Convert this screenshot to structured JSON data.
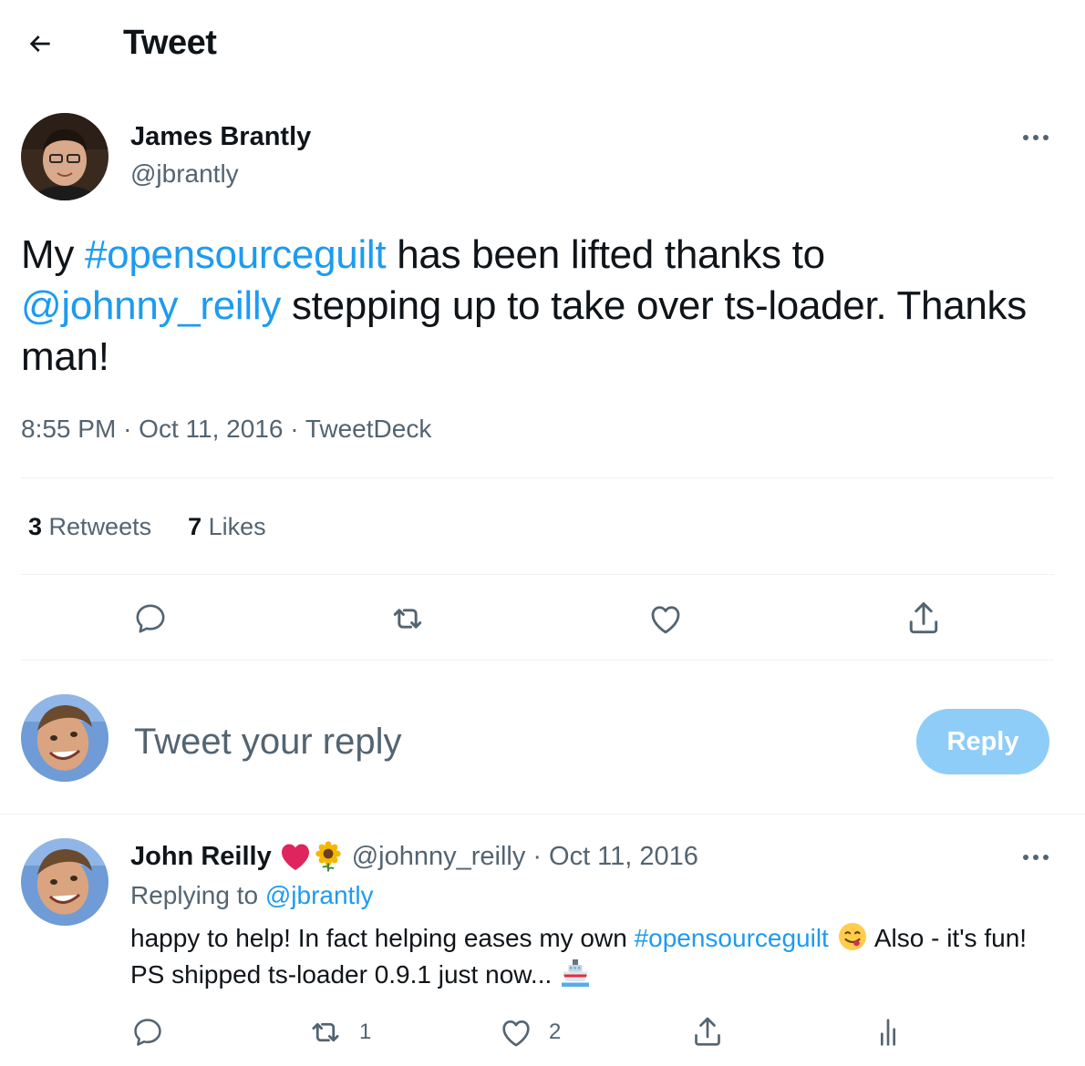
{
  "header": {
    "title": "Tweet"
  },
  "tweet": {
    "author_name": "James Brantly",
    "author_handle": "@jbrantly",
    "text_parts": [
      "My ",
      "#opensourceguilt",
      " has been lifted thanks to ",
      "@johnny_reilly",
      " stepping up to take over ts-loader. Thanks man!"
    ],
    "time": "8:55 PM",
    "date": "Oct 11, 2016",
    "source": "TweetDeck",
    "separator": "·",
    "retweets_count": "3",
    "retweets_label": "Retweets",
    "likes_count": "7",
    "likes_label": "Likes"
  },
  "composer": {
    "placeholder": "Tweet your reply",
    "reply_button": "Reply"
  },
  "reply": {
    "author_name": "John Reilly",
    "author_handle": "@johnny_reilly",
    "separator": "·",
    "date": "Oct 11, 2016",
    "replying_prefix": "Replying to ",
    "replying_to": "@jbrantly",
    "text_part1": "happy to help! In fact helping eases my own ",
    "text_hashtag": "#opensourceguilt",
    "text_part2": " Also - it's fun! PS shipped ts-loader 0.9.1 just now... ",
    "retweet_count": "1",
    "like_count": "2"
  },
  "colors": {
    "accent": "#1d9bf0",
    "muted": "#536471",
    "reply_button_disabled": "#8ecdf8",
    "heart": "#e0245e",
    "divider": "#eff3f4"
  },
  "icons": [
    "back-arrow-icon",
    "more-icon",
    "reply-icon",
    "retweet-icon",
    "like-icon",
    "share-icon",
    "analytics-icon",
    "red-heart-emoji",
    "sunflower-emoji",
    "savoring-face-emoji",
    "ship-emoji"
  ]
}
